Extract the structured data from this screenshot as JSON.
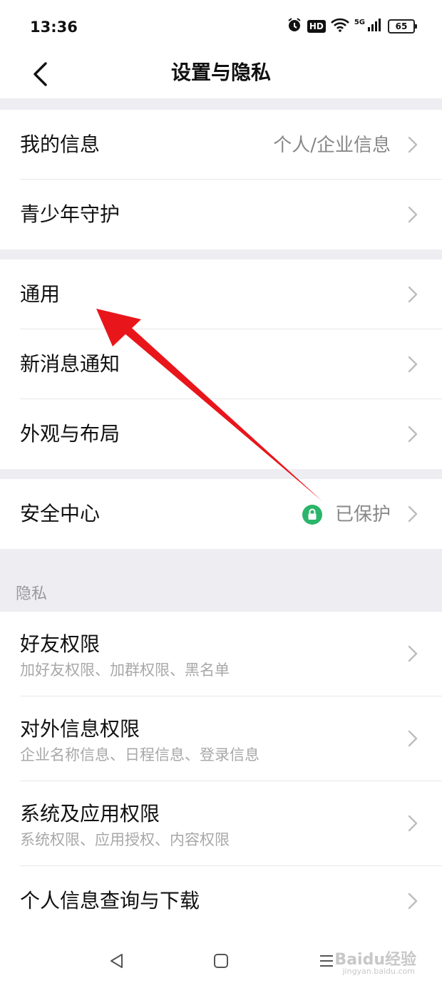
{
  "status": {
    "time": "13:36",
    "hd": "HD",
    "network": "5G",
    "battery": "65"
  },
  "header": {
    "title": "设置与隐私"
  },
  "group1": [
    {
      "label": "我的信息",
      "value": "个人/企业信息"
    },
    {
      "label": "青少年守护"
    }
  ],
  "group2": [
    {
      "label": "通用"
    },
    {
      "label": "新消息通知"
    },
    {
      "label": "外观与布局"
    }
  ],
  "group3": [
    {
      "label": "安全中心",
      "value": "已保护"
    }
  ],
  "privacy": {
    "title": "隐私",
    "items": [
      {
        "label": "好友权限",
        "sub": "加好友权限、加群权限、黑名单"
      },
      {
        "label": "对外信息权限",
        "sub": "企业名称信息、日程信息、登录信息"
      },
      {
        "label": "系统及应用权限",
        "sub": "系统权限、应用授权、内容权限"
      },
      {
        "label": "个人信息查询与下载"
      }
    ]
  },
  "watermark": {
    "brand": "Baidu经验",
    "url": "jingyan.baidu.com"
  },
  "colors": {
    "accent_green": "#2bb56a",
    "annotation_red": "#e8161b"
  }
}
